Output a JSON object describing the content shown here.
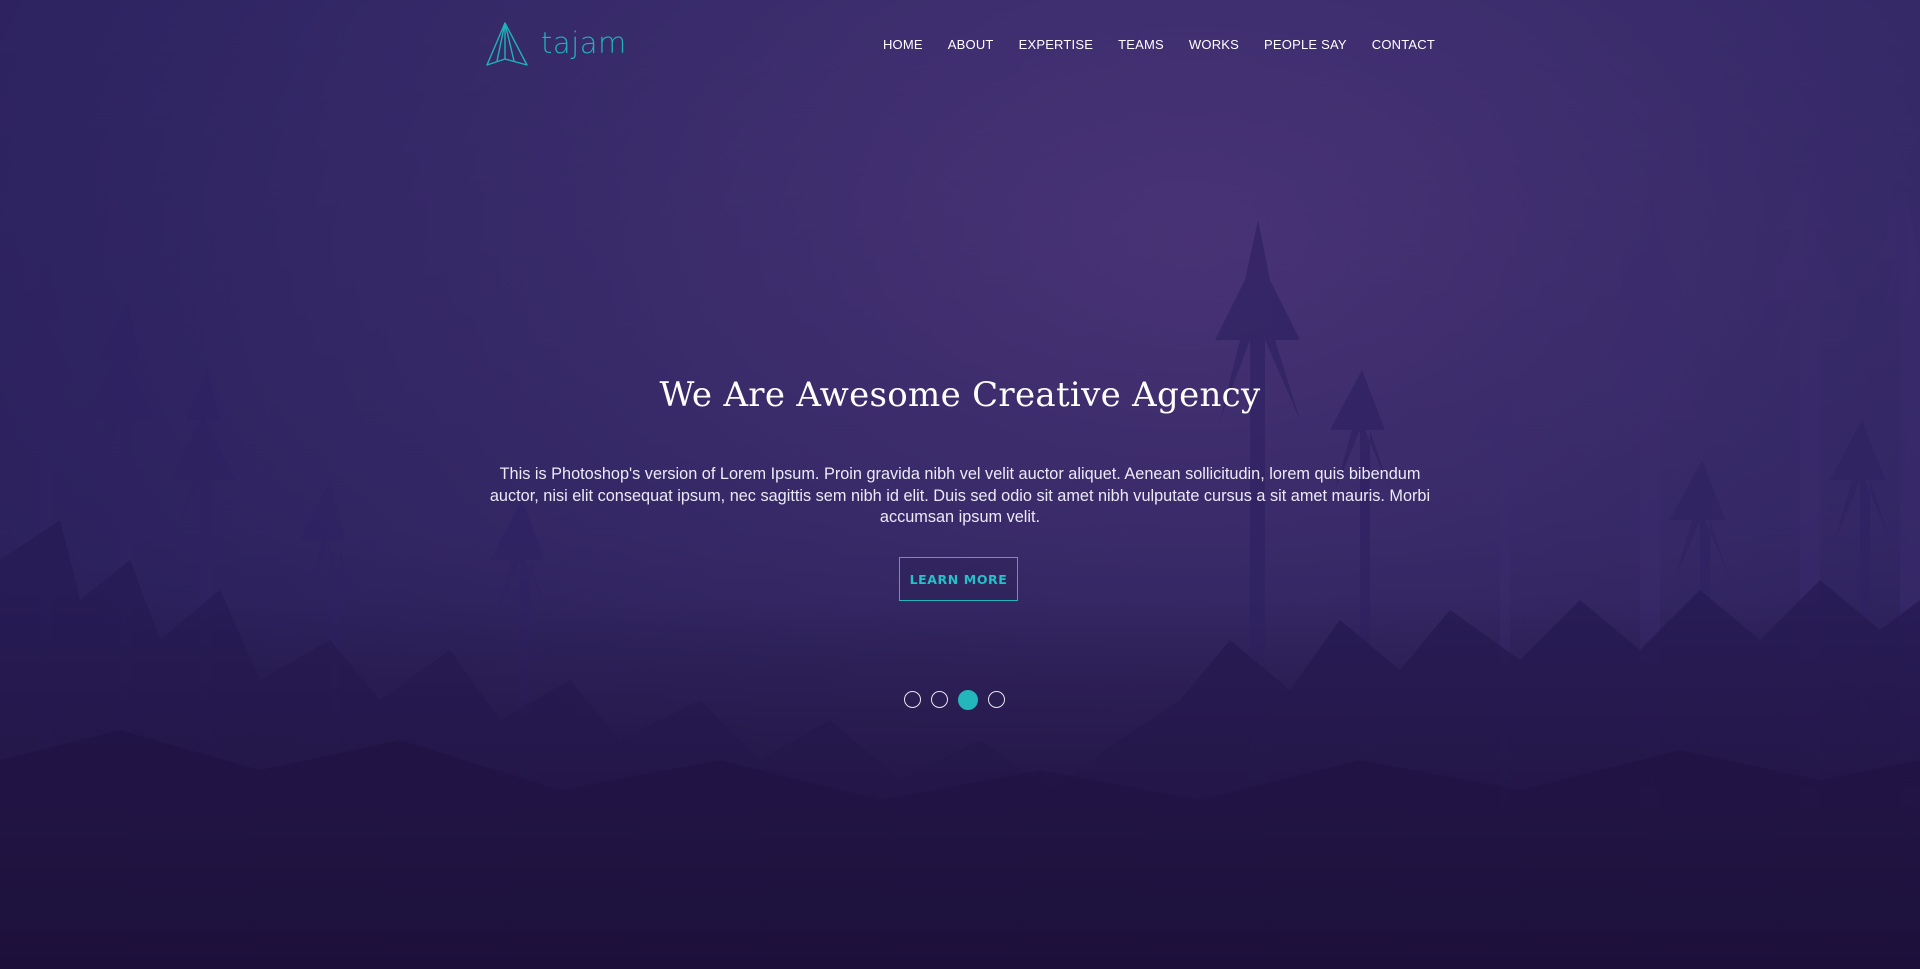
{
  "brand": {
    "name": "tajam",
    "accent_color": "#23b7bc"
  },
  "nav": {
    "items": [
      "HOME",
      "ABOUT",
      "EXPERTISE",
      "TEAMS",
      "WORKS",
      "PEOPLE SAY",
      "CONTACT"
    ]
  },
  "hero": {
    "headline": "We Are Awesome Creative Agency",
    "body": "This is Photoshop's version of Lorem Ipsum. Proin gravida nibh vel velit auctor aliquet. Aenean sollicitudin, lorem quis bibendum auctor, nisi elit consequat ipsum, nec sagittis sem nibh id elit. Duis sed odio sit amet nibh vulputate cursus a sit amet mauris. Morbi accumsan ipsum velit.",
    "cta_label": "LEARN MORE",
    "background": "misty-purple-forest"
  },
  "slider": {
    "count": 4,
    "active_index": 2
  }
}
